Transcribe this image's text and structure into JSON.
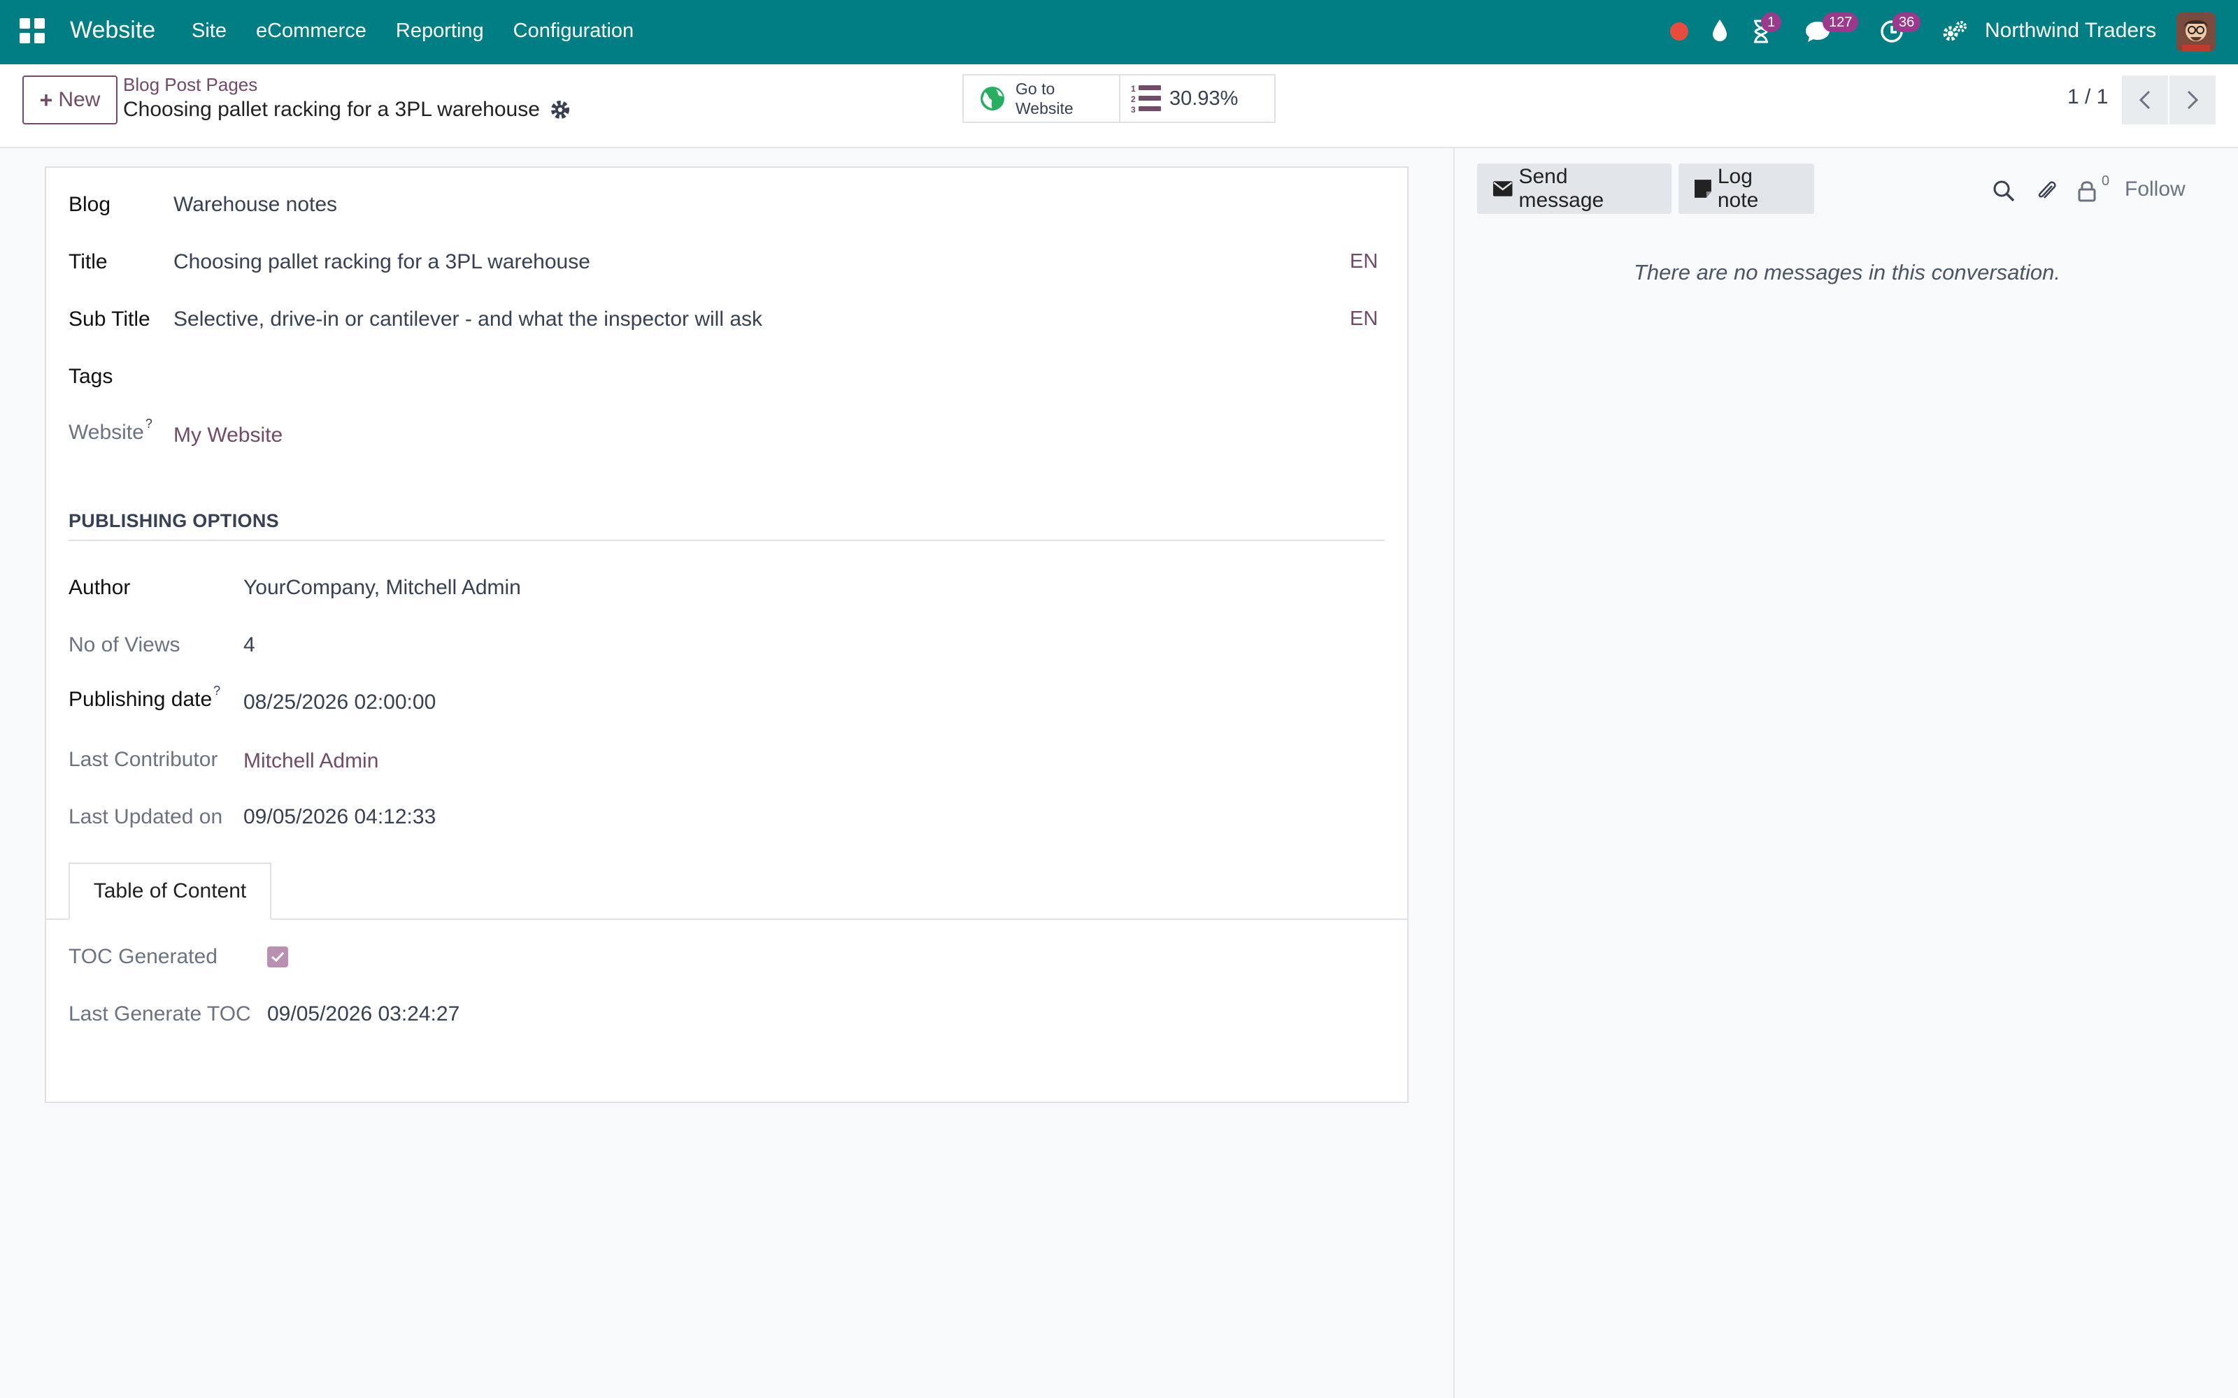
{
  "navbar": {
    "brand": "Website",
    "menu": [
      "Site",
      "eCommerce",
      "Reporting",
      "Configuration"
    ],
    "activity_badge": "1",
    "messages_badge": "127",
    "clock_badge": "36",
    "company": "Northwind Traders"
  },
  "control_panel": {
    "new_label": "New",
    "breadcrumb_parent": "Blog Post Pages",
    "breadcrumb_current": "Choosing pallet racking for a 3PL warehouse",
    "go_to_line1": "Go to",
    "go_to_line2": "Website",
    "seo_score": "30.93%",
    "pager": "1 / 1"
  },
  "form": {
    "blog_label": "Blog",
    "blog_value": "Warehouse notes",
    "title_label": "Title",
    "title_value": "Choosing pallet racking for a 3PL warehouse",
    "title_lang": "EN",
    "subtitle_label": "Sub Title",
    "subtitle_value": "Selective, drive-in or cantilever - and what the inspector will ask",
    "subtitle_lang": "EN",
    "tags_label": "Tags",
    "website_label": "Website",
    "website_help": "?",
    "website_value": "My Website",
    "section_title": "PUBLISHING OPTIONS",
    "author_label": "Author",
    "author_value": "YourCompany, Mitchell Admin",
    "views_label": "No of Views",
    "views_value": "4",
    "pubdate_label": "Publishing date",
    "pubdate_help": "?",
    "pubdate_value": "08/25/2026 02:00:00",
    "contributor_label": "Last Contributor",
    "contributor_value": "Mitchell Admin",
    "updated_label": "Last Updated on",
    "updated_value": "09/05/2026 04:12:33",
    "tab_label": "Table of Content",
    "toc_generated_label": "TOC Generated",
    "toc_generated_checked": true,
    "last_toc_label": "Last Generate TOC",
    "last_toc_value": "09/05/2026 03:24:27"
  },
  "chatter": {
    "send_message": "Send message",
    "log_note": "Log note",
    "followers_count": "0",
    "follow": "Follow",
    "empty_text": "There are no messages in this conversation."
  },
  "colors": {
    "navbar": "#017e84",
    "accent": "#714b67",
    "badge": "#9b3a8c",
    "record_dot": "#e74c3c"
  },
  "icons": [
    "apps-grid-icon",
    "record-dot-icon",
    "drop-icon",
    "hourglass-icon",
    "chat-bubble-icon",
    "clock-icon",
    "settings-icon",
    "gear-icon",
    "globe-icon",
    "numbered-list-icon",
    "chevron-left-icon",
    "chevron-right-icon",
    "envelope-icon",
    "note-icon",
    "search-icon",
    "paperclip-icon",
    "lock-icon"
  ]
}
